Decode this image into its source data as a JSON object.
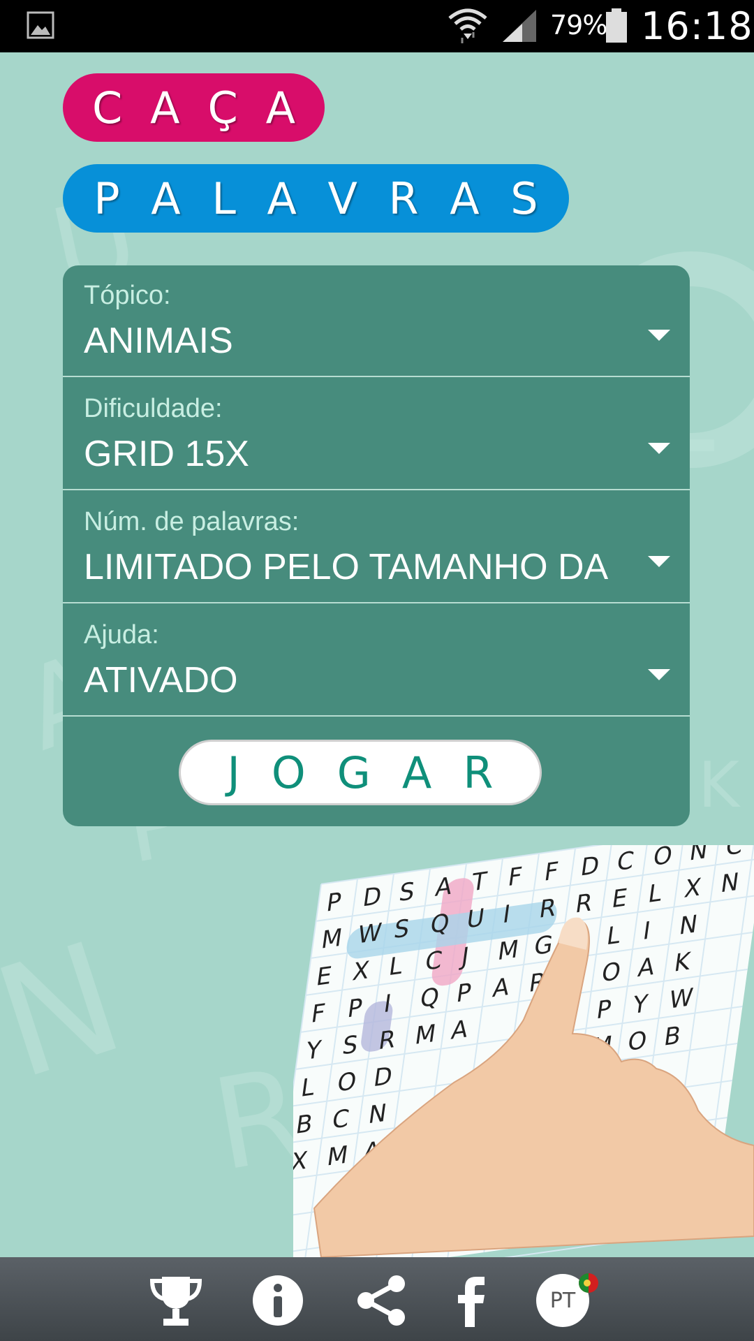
{
  "status_bar": {
    "battery_percent": "79%",
    "time": "16:18",
    "icons": [
      "gallery-icon",
      "wifi-icon",
      "signal-icon",
      "battery-icon"
    ]
  },
  "title": {
    "line1": [
      "C",
      "A",
      "Ç",
      "A"
    ],
    "line2": [
      "P",
      "A",
      "L",
      "A",
      "V",
      "R",
      "A",
      "S"
    ],
    "line1_color": "#d80d6a",
    "line2_color": "#0790d8"
  },
  "form": {
    "topic": {
      "label": "Tópico:",
      "value": "ANIMAIS"
    },
    "difficulty": {
      "label": "Dificuldade:",
      "value": "GRID 15X"
    },
    "word_count": {
      "label": "Núm. de palavras:",
      "value": "LIMITADO PELO TAMANHO DA"
    },
    "help": {
      "label": "Ajuda:",
      "value": "ATIVADO"
    },
    "play_button": [
      "J",
      "O",
      "G",
      "A",
      "R"
    ],
    "panel_color": "#478c7d"
  },
  "illustration": {
    "rows": [
      "PDSATFFDCONC",
      "MWSQUIRRELXN",
      "EXLCJMGOLIN",
      "FPIQPARMOAK",
      "YSRMA  XPYW",
      "LOD    RMOB",
      "BCN    UHP",
      "XMA     VG"
    ]
  },
  "bottom_bar": {
    "icons": [
      "trophy-icon",
      "info-icon",
      "share-icon",
      "facebook-icon",
      "language-icon"
    ],
    "language_code": "PT"
  }
}
